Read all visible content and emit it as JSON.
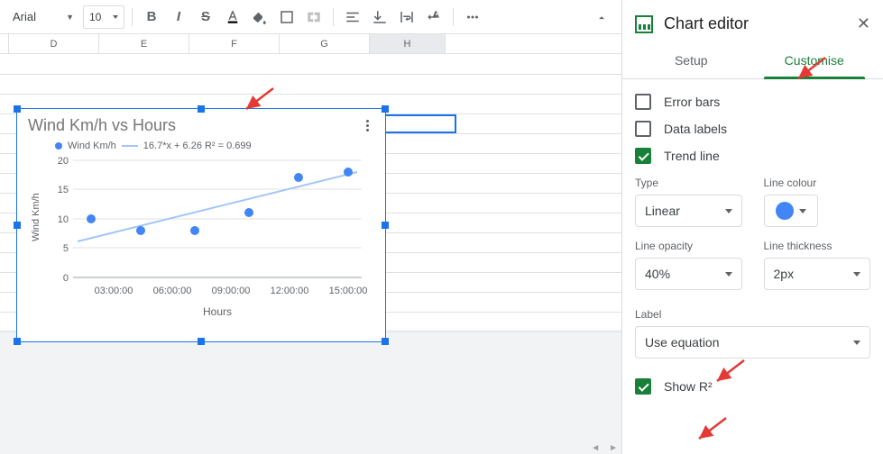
{
  "toolbar": {
    "font": "Arial",
    "size": "10",
    "bold": "B",
    "italic": "I",
    "strike": "S"
  },
  "columns": [
    "D",
    "E",
    "F",
    "G",
    "H"
  ],
  "chart_data": {
    "type": "scatter",
    "title": "Wind Km/h vs Hours",
    "xlabel": "Hours",
    "ylabel": "Wind Km/h",
    "series_name": "Wind Km/h",
    "trend_equation": "16.7*x + 6.26 R² = 0.699",
    "categories": [
      "03:00:00",
      "06:00:00",
      "09:00:00",
      "12:00:00",
      "15:00:00"
    ],
    "values": [
      10,
      8,
      8,
      11,
      17,
      18
    ],
    "trend_line": {
      "slope": 16.7,
      "intercept": 6.26,
      "r2": 0.699
    },
    "ylim": [
      0,
      20
    ],
    "yticks": [
      0,
      5,
      10,
      15,
      20
    ]
  },
  "sidebar": {
    "title": "Chart editor",
    "tabs": {
      "setup": "Setup",
      "customise": "Customise"
    },
    "error_bars": "Error bars",
    "data_labels": "Data labels",
    "trend_line": "Trend line",
    "type_label": "Type",
    "type_value": "Linear",
    "colour_label": "Line colour",
    "opacity_label": "Line opacity",
    "opacity_value": "40%",
    "thickness_label": "Line thickness",
    "thickness_value": "2px",
    "label_label": "Label",
    "label_value": "Use equation",
    "show_r2": "Show R²"
  }
}
